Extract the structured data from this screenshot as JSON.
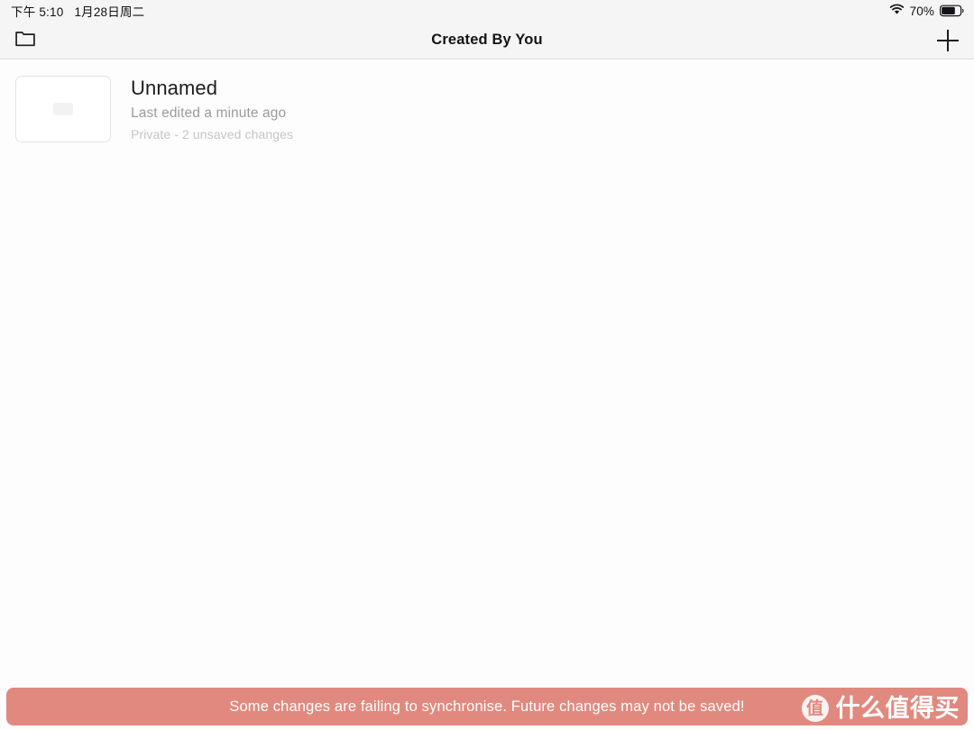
{
  "status_bar": {
    "time": "下午 5:10",
    "date": "1月28日周二",
    "wifi_icon": "wifi-icon",
    "battery_percent": "70%",
    "battery_level": 70,
    "battery_icon": "battery-icon"
  },
  "nav_bar": {
    "left_button_icon": "folder-icon",
    "title": "Created By You",
    "right_button_icon": "plus-icon"
  },
  "documents": [
    {
      "title": "Unnamed",
      "subtitle": "Last edited a minute ago",
      "meta": "Private - 2 unsaved changes",
      "thumbnail_icon": "image-placeholder-icon"
    }
  ],
  "banner": {
    "message": "Some changes are failing to synchronise. Future changes may not be saved!",
    "background_color": "#E2897F",
    "text_color": "#FFFFFF"
  },
  "watermark": {
    "badge_text": "值",
    "text": "什么值得买"
  },
  "colors": {
    "status_bar_bg": "#F5F5F6",
    "nav_bar_bg": "#F5F5F6",
    "content_bg": "#FDFDFD",
    "title_text": "#131416",
    "subtitle_text": "#9B9B9E",
    "meta_text": "#C6C6C8",
    "banner_bg": "#E2897F"
  }
}
